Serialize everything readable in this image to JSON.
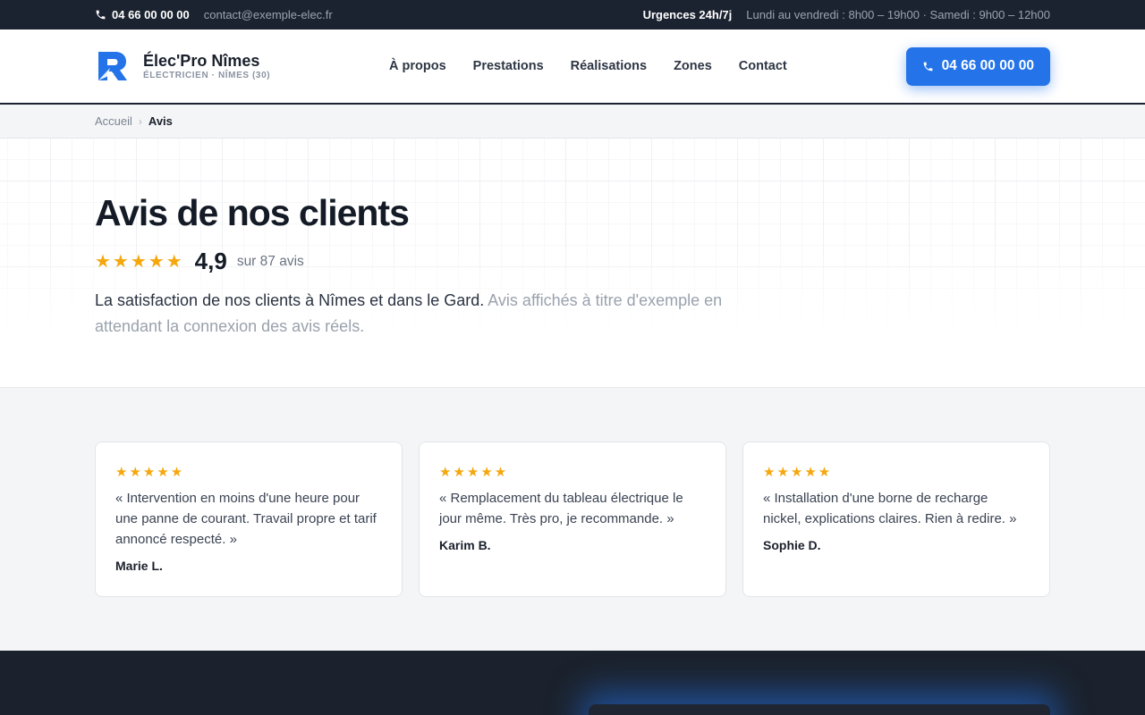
{
  "topbar": {
    "phone": "04 66 00 00 00",
    "email": "contact@exemple-elec.fr",
    "urgent": "Urgences 24h/7j",
    "hours": "Lundi au vendredi : 8h00 – 19h00 · Samedi : 9h00 – 12h00"
  },
  "brand": {
    "name": "Élec'Pro Nîmes",
    "tagline": "ÉLECTRICIEN · NÎMES (30)",
    "accent": "#2473e8"
  },
  "nav": {
    "items": [
      "À propos",
      "Prestations",
      "Réalisations",
      "Zones",
      "Contact"
    ]
  },
  "cta": {
    "label": "04 66 00 00 00"
  },
  "breadcrumb": {
    "home": "Accueil",
    "separator": "›",
    "current": "Avis"
  },
  "hero": {
    "title": "Avis de nos clients",
    "stars": "★★★★★",
    "score": "4,9",
    "count": "sur 87 avis",
    "desc_strong": "La satisfaction de nos clients à Nîmes et dans le Gard.",
    "desc_muted": "Avis affichés à titre d'exemple en attendant la connexion des avis réels."
  },
  "reviews": [
    {
      "stars": "★★★★★",
      "text": "« Intervention en moins d'une heure pour une panne de courant. Travail propre et tarif annoncé respecté. »",
      "author": "Marie L."
    },
    {
      "stars": "★★★★★",
      "text": "« Remplacement du tableau électrique le jour même. Très pro, je recommande. »",
      "author": "Karim B."
    },
    {
      "stars": "★★★★★",
      "text": "« Installation d'une borne de recharge nickel, explications claires. Rien à redire. »",
      "author": "Sophie D."
    }
  ],
  "icons": {
    "phone": "phone-icon",
    "logo": "logo-mark"
  }
}
